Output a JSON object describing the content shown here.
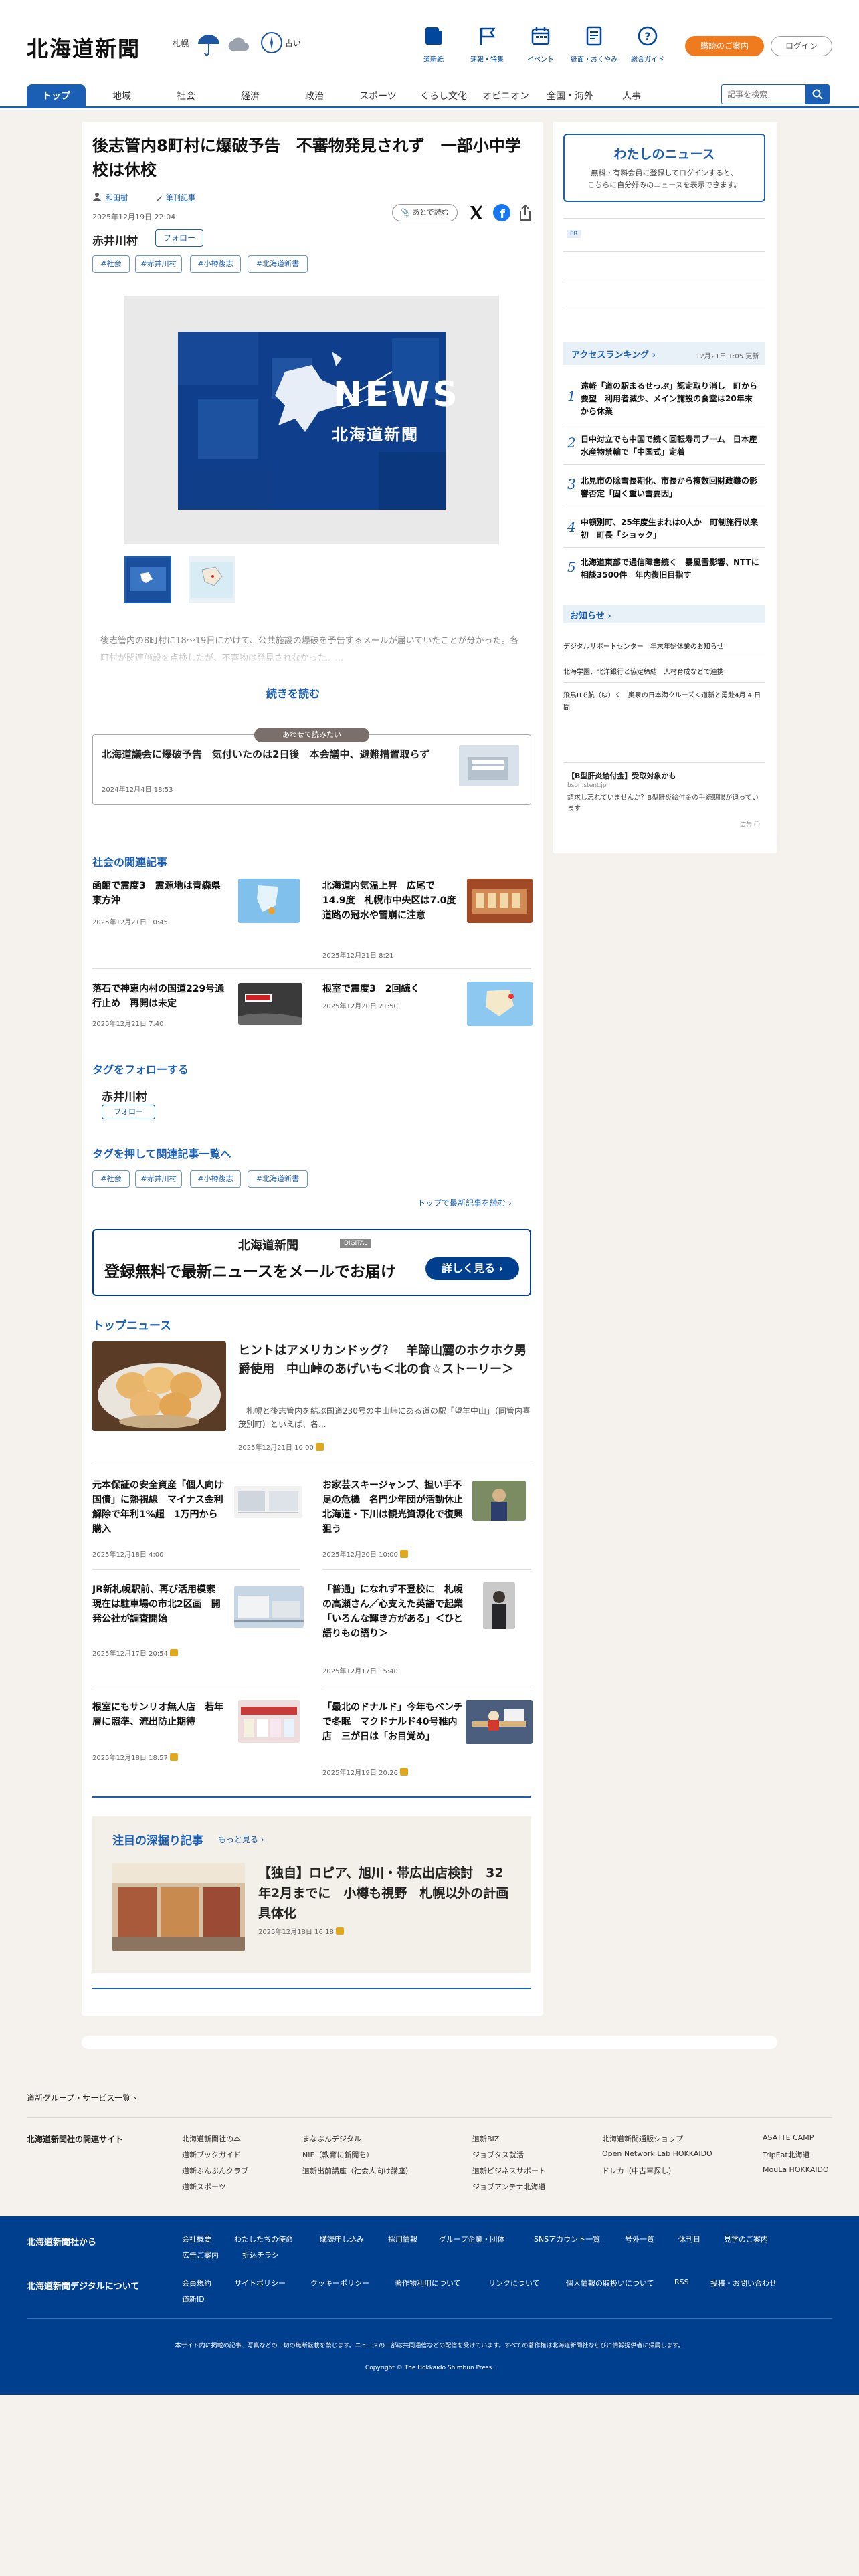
{
  "header": {
    "logo": "北海道新聞",
    "weather_city": "札幌",
    "weather_label": "占い",
    "nav": [
      {
        "label": "道新紙"
      },
      {
        "label": "速報・特集"
      },
      {
        "label": "イベント"
      },
      {
        "label": "紙面・おくやみ"
      },
      {
        "label": "総合ガイド"
      }
    ],
    "subscribe_label": "購読のご案内",
    "login_label": "ログイン",
    "categories": [
      "トップ",
      "地域",
      "社会",
      "経済",
      "政治",
      "スポーツ",
      "くらし文化",
      "オピニオン",
      "全国・海外",
      "人事"
    ],
    "search_placeholder": "記事を検索"
  },
  "article": {
    "title": "後志管内8町村に爆破予告　不審物発見されず　一部小中学校は休校",
    "author": "和田樹",
    "follow_author": "筆刊記事",
    "datetime": "2025年12月19日 22:04",
    "bookmark_label": "あとで読む",
    "tag_name": "赤井川村",
    "follow_label": "フォロー",
    "tags": [
      "#社会",
      "#赤井川村",
      "#小樽後志",
      "#北海道新書"
    ],
    "image_caption_text": "NEWS",
    "image_brand": "北海道新聞",
    "lead": "後志管内の8町村に18～19日にかけて、公共施設の爆破を予告するメールが届いていたことが分かった。各町村が関連施設を点検したが、不審物は発見されなかった。...",
    "read_more": "続きを読む",
    "related_badge": "あわせて読みたい",
    "related_title": "北海道議会に爆破予告　気付いたのは2日後　本会議中、避難措置取らず",
    "related_date": "2024年12月4日 18:53"
  },
  "social": {
    "heading": "社会の関連記事",
    "items": [
      {
        "title": "函館で震度3　震源地は青森県東方沖",
        "date": "2025年12月21日 10:45"
      },
      {
        "title": "北海道内気温上昇　広尾で14.9度　札幌市中央区は7.0度　道路の冠水や雪崩に注意",
        "date": "2025年12月21日 8:21"
      },
      {
        "title": "落石で神恵内村の国道229号通行止め　再開は未定",
        "date": "2025年12月21日 7:40"
      },
      {
        "title": "根室で震度3　2回続く",
        "date": "2025年12月20日 21:50"
      }
    ]
  },
  "follow_tag": {
    "heading": "タグをフォローする",
    "name": "赤井川村",
    "button": "フォロー",
    "list_heading": "タグを押して関連記事一覧へ",
    "tags": [
      "#社会",
      "#赤井川村",
      "#小樽後志",
      "#北海道新書"
    ],
    "latest_link": "トップで最新記事を読む"
  },
  "banner": {
    "brand": "北海道新聞",
    "digital": "DIGITAL",
    "text": "登録無料で最新ニュースをメールでお届け",
    "button": "詳しく見る"
  },
  "top_news": {
    "heading": "トップニュース",
    "lead_title": "ヒントはアメリカンドッグ？　羊蹄山麓のホクホク男爵使用　中山峠のあげいも＜北の食☆ストーリー＞",
    "lead_text": "札幌と後志管内を結ぶ国道230号の中山峠にある道の駅「望羊中山」（同管内喜茂別町）といえば、名...",
    "lead_date": "2025年12月21日 10:00",
    "items": [
      {
        "title": "元本保証の安全資産「個人向け国債」に熱視線　マイナス金利解除で年利1%超　1万円から購入",
        "date": "2025年12月18日 4:00"
      },
      {
        "title": "お家芸スキージャンプ、担い手不足の危機　名門少年団が活動休止　北海道・下川は観光資源化で復興狙う",
        "date": "2025年12月20日 10:00"
      },
      {
        "title": "JR新札幌駅前、再び活用模索　現在は駐車場の市北2区画　開発公社が調査開始",
        "date": "2025年12月17日 20:54"
      },
      {
        "title": "「普通」になれず不登校に　札幌の高瀬さん／心支えた英語で起業「いろんな輝き方がある」＜ひと語りもの語り＞",
        "date": "2025年12月17日 15:40"
      },
      {
        "title": "根室にもサンリオ無人店　若年層に照準、流出防止期待",
        "date": "2025年12月18日 18:57"
      },
      {
        "title": "「最北のドナルド」今年もベンチで冬眠　マクドナルド40号稚内店　三が日は「お目覚め」",
        "date": "2025年12月19日 20:26"
      }
    ]
  },
  "deep": {
    "heading": "注目の深掘り記事",
    "more": "もっと見る",
    "title": "【独自】ロピア、旭川・帯広出店検討　32年2月までに　小樽も視野　札幌以外の計画具体化",
    "date": "2025年12月18日 16:18"
  },
  "sidebar": {
    "my_news_title": "わたしのニュース",
    "my_news_text1": "無料・有料会員に登録してログインすると、",
    "my_news_login": "ログイン",
    "my_news_text2": "こちらに自分好みのニュースを表示できます。",
    "pr_label": "PR",
    "ranking_title": "アクセスランキング",
    "ranking_updated": "12月21日 1:05 更新",
    "ranking": [
      "遠軽「道の駅まるせっぷ」認定取り消し　町から要望　利用者減少、メイン施設の食堂は20年末から休業",
      "日中対立でも中国で続く回転寿司ブーム　日本産水産物禁輸で「中国式」定着",
      "北見市の除雪長期化、市長から複数回財政難の影響否定「固く重い雪要因」",
      "中頓別町、25年度生まれは0人か　町制施行以来初　町長「ショック」",
      "北海道東部で通信障害続く　暴風雪影響、NTTに相談3500件　年内復旧目指す"
    ],
    "notice_title": "お知らせ",
    "notices": [
      "デジタルサポートセンター　年末年始休業のお知らせ",
      "北海学園、北洋銀行と協定締結　人材育成などで連携",
      "飛鳥Ⅲで航（ゆ）く　奥泉の日本海クルーズ＜道新と勇赴4月 4 日間"
    ],
    "ad_title": "【B型肝炎給付金】受取対象かも",
    "ad_source": "bson.stent.jp",
    "ad_text": "請求し忘れていませんか？B型肝炎給付金の手続期限が迫っています",
    "ad_label": "広告"
  },
  "footer": {
    "group_link": "道新グループ・サービス一覧",
    "related_sites_label": "北海道新聞社の関連サイト",
    "sites": [
      [
        "北海道新聞社の本",
        "道新ブックガイド",
        "道新ぶんぶんクラブ",
        "道新スポーツ"
      ],
      [
        "まなぶんデジタル",
        "NIE（教育に新聞を）",
        "道新出前講座（社会人向け講座）"
      ],
      [
        "道新BIZ",
        "ジョブタス就活",
        "道新ビジネスサポート",
        "ジョブアンテナ北海道"
      ],
      [
        "北海道新聞通販ショップ",
        "Open Network Lab HOKKAIDO",
        "ドレカ（中古車探し）"
      ],
      [
        "ASATTE CAMP",
        "TripEat北海道",
        "MouLa HOKKAIDO"
      ]
    ],
    "from_company": "北海道新聞社から",
    "company_links": [
      "会社概要",
      "わたしたちの使命",
      "購読申し込み",
      "採用情報",
      "グループ企業・団体",
      "SNSアカウント一覧",
      "号外一覧",
      "休刊日",
      "見学のご案内",
      "広告ご案内",
      "折込チラシ"
    ],
    "about_digital": "北海道新聞デジタルについて",
    "digital_links": [
      "会員規約",
      "サイトポリシー",
      "クッキーポリシー",
      "著作物利用について",
      "リンクについて",
      "個人情報の取扱いについて",
      "RSS",
      "投稿・お問い合わせ",
      "道新ID"
    ],
    "disclaimer": "本サイト内に掲載の記事、写真などの一切の無断転載を禁じます。ニュースの一部は共同通信などの配信を受けています。すべての著作権は北海道新聞社ならびに情報提供者に帰属します。",
    "copyright": "Copyright © The Hokkaido Shimbun Press."
  }
}
